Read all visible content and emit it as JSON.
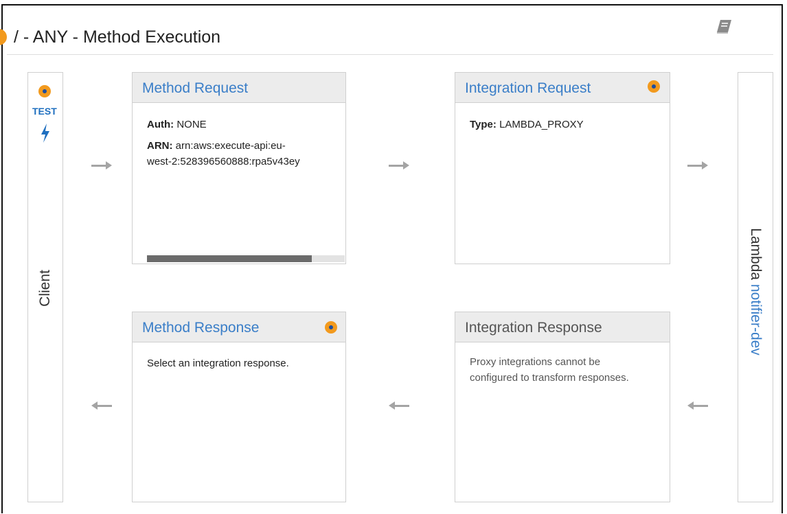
{
  "header": {
    "title": "/ - ANY - Method Execution",
    "status_color": "#f29a1e",
    "docs_icon": "book-icon"
  },
  "client": {
    "label": "Client",
    "test_label": "TEST",
    "test_icon": "lightning-bolt-icon"
  },
  "lambda": {
    "prefix": "Lambda",
    "function_name": "notifier-dev"
  },
  "method_request": {
    "title": "Method Request",
    "fields": [
      {
        "key": "Auth:",
        "value": "NONE"
      },
      {
        "key": "ARN:",
        "value_line1": "arn:aws:execute-api:eu-",
        "value_line2": "west-2:528396560888:rpa5v43ey"
      }
    ]
  },
  "integration_request": {
    "title": "Integration Request",
    "fields": [
      {
        "key": "Type:",
        "value": "LAMBDA_PROXY"
      }
    ]
  },
  "method_response": {
    "title": "Method Response",
    "text": "Select an integration response."
  },
  "integration_response": {
    "title": "Integration Response",
    "text": "Proxy integrations cannot be configured to transform responses."
  },
  "colors": {
    "link": "#3a7ec8",
    "accent_dot": "#f29a1e",
    "arrow": "#a4a4a4"
  }
}
